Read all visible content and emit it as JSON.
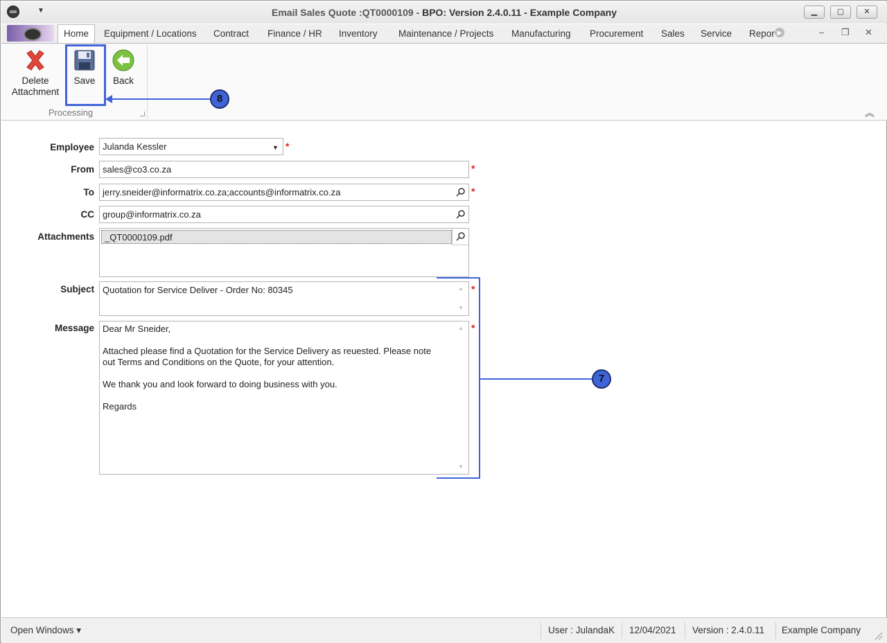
{
  "window": {
    "title_prefix": "Email Sales Quote :QT0000109 - ",
    "title_main": "BPO: Version 2.4.0.11 - Example Company",
    "minimize_label": "▁",
    "maximize_label": "▢",
    "close_label": "✕"
  },
  "ribbon_tabs": [
    {
      "label": "Home"
    },
    {
      "label": "Equipment / Locations"
    },
    {
      "label": "Contract"
    },
    {
      "label": "Finance / HR"
    },
    {
      "label": "Inventory"
    },
    {
      "label": "Maintenance / Projects"
    },
    {
      "label": "Manufacturing"
    },
    {
      "label": "Procurement"
    },
    {
      "label": "Sales"
    },
    {
      "label": "Service"
    },
    {
      "label": "Repor"
    }
  ],
  "ribbon": {
    "buttons": {
      "delete_line1": "Delete",
      "delete_line2": "Attachment",
      "save": "Save",
      "back": "Back"
    },
    "group_label": "Processing"
  },
  "form": {
    "employee": {
      "label": "Employee",
      "value": "Julanda Kessler"
    },
    "from": {
      "label": "From",
      "value": "sales@co3.co.za"
    },
    "to": {
      "label": "To",
      "value": "jerry.sneider@informatrix.co.za;accounts@informatrix.co.za"
    },
    "cc": {
      "label": "CC",
      "value": "group@informatrix.co.za"
    },
    "attachments": {
      "label": "Attachments",
      "items": [
        "_QT0000109.pdf"
      ]
    },
    "subject": {
      "label": "Subject",
      "value": "Quotation for Service Deliver - Order No: 80345"
    },
    "message": {
      "label": "Message",
      "lines": [
        "Dear Mr Sneider,",
        "",
        "Attached please find a Quotation for the Service Delivery as reuested.  Please note",
        "out Terms and Conditions on the Quote, for your attention.",
        "",
        "We thank you and look forward to doing business with you.",
        "",
        "Regards"
      ]
    },
    "required_marker": "*"
  },
  "annotations": {
    "callout_7": "7",
    "callout_8": "8"
  },
  "statusbar": {
    "open_windows": "Open Windows ▾",
    "user": "User : JulandaK",
    "date": "12/04/2021",
    "version": "Version : 2.4.0.11",
    "company": "Example Company"
  },
  "colors": {
    "accent": "#3f63d8",
    "required": "#e02020"
  }
}
